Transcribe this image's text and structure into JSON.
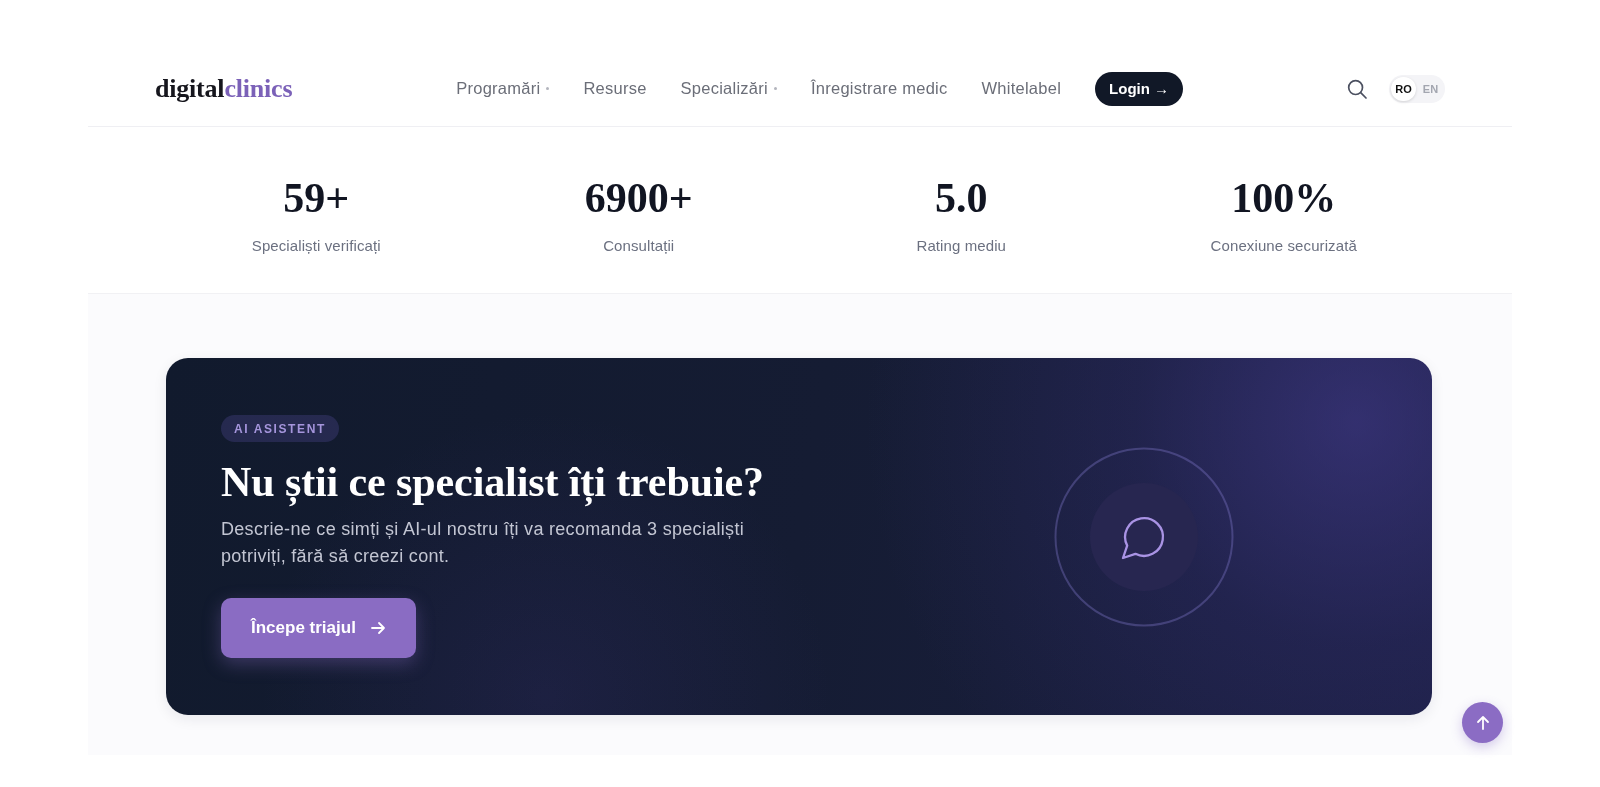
{
  "header": {
    "logo": {
      "first": "digital",
      "second": "clinics"
    },
    "nav": [
      {
        "label": "Programări",
        "dropdown": true
      },
      {
        "label": "Resurse",
        "dropdown": false
      },
      {
        "label": "Specializări",
        "dropdown": true
      },
      {
        "label": "Înregistrare medic",
        "dropdown": false
      },
      {
        "label": "Whitelabel",
        "dropdown": false
      }
    ],
    "login_button": "Login →",
    "languages": [
      {
        "label": "RO",
        "selected": true
      },
      {
        "label": "EN",
        "selected": false
      }
    ]
  },
  "stats": [
    {
      "value": "59+",
      "label": "Specialiști verificați"
    },
    {
      "value": "6900+",
      "label": "Consultații"
    },
    {
      "value": "5.0",
      "label": "Rating mediu"
    },
    {
      "value": "100%",
      "label": "Conexiune securizată"
    }
  ],
  "ai_banner": {
    "badge": "AI ASISTENT",
    "title": "Nu știi ce specialist îți trebuie?",
    "description": "Descrie-ne ce simți și AI-ul nostru îți va recomanda 3 specialiști potriviți, fără să creezi cont.",
    "button": "Începe triajul"
  }
}
